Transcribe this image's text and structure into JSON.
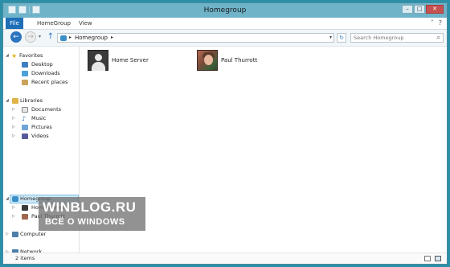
{
  "window": {
    "title": "Homegroup"
  },
  "ribbon": {
    "tabs": [
      "File",
      "HomeGroup",
      "View"
    ]
  },
  "address": {
    "path": [
      "Homegroup"
    ]
  },
  "search": {
    "placeholder": "Search Homegroup"
  },
  "nav": {
    "favorites": {
      "label": "Favorites",
      "items": [
        "Desktop",
        "Downloads",
        "Recent places"
      ]
    },
    "libraries": {
      "label": "Libraries",
      "items": [
        "Documents",
        "Music",
        "Pictures",
        "Videos"
      ]
    },
    "homegroup": {
      "label": "Homegroup",
      "items": [
        "Home Server",
        "Paul Thurrott"
      ]
    },
    "computer": {
      "label": "Computer"
    },
    "network": {
      "label": "Network"
    }
  },
  "content": {
    "items": [
      {
        "name": "Home Server"
      },
      {
        "name": "Paul Thurrott"
      }
    ]
  },
  "status": {
    "count": "2 items"
  },
  "watermark": {
    "line1": "WINBLOG.RU",
    "line2": "ВСЁ О WINDOWS"
  },
  "colors": {
    "accent": "#1f6fb8",
    "titlebar": "#6fb3c9",
    "selection": "#cde8f7"
  }
}
